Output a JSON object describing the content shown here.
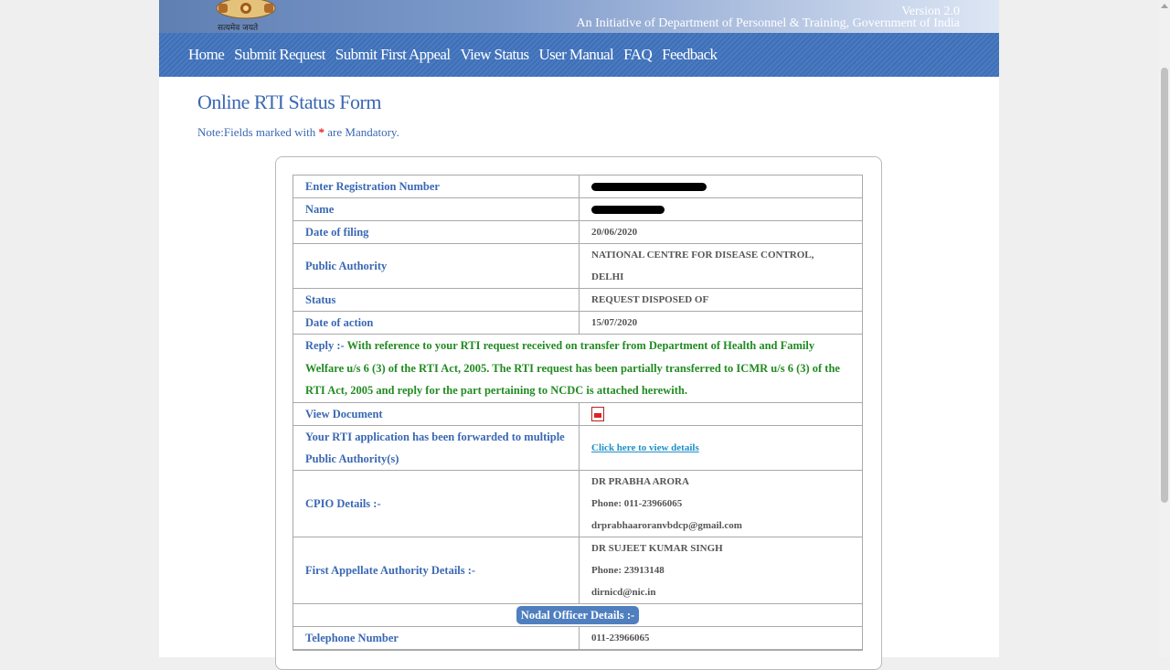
{
  "header": {
    "emblem_caption": "सत्यमेव जयते",
    "version": "Version 2.0",
    "initiative": "An Initiative of Department of Personnel & Training, Government of India"
  },
  "nav": {
    "items": [
      "Home",
      "Submit Request",
      "Submit First Appeal",
      "View Status",
      "User Manual",
      "FAQ",
      "Feedback"
    ]
  },
  "page": {
    "title": "Online RTI Status Form",
    "note_prefix": "Note:Fields marked with",
    "note_star": "*",
    "note_suffix": "are Mandatory."
  },
  "details": {
    "registration_label": "Enter Registration Number",
    "name_label": "Name",
    "date_filing_label": "Date of filing",
    "date_filing": "20/06/2020",
    "public_authority_label": "Public Authority",
    "public_authority_line1": "NATIONAL CENTRE FOR DISEASE CONTROL,",
    "public_authority_line2": "DELHI",
    "status_label": "Status",
    "status": "REQUEST DISPOSED OF",
    "date_action_label": "Date of action",
    "date_action": "15/07/2020",
    "reply_label": "Reply :-",
    "reply_text": "With reference to your RTI request received on transfer from Department of Health and Family Welfare u/s 6 (3) of the RTI Act, 2005.  The RTI request has been partially transferred to ICMR u/s 6 (3) of the RTI Act, 2005 and reply for the part pertaining to NCDC is attached herewith.",
    "view_document_label": "View Document",
    "forwarded_label": "Your RTI application has been forwarded to multiple Public Authority(s)",
    "forwarded_link": "Click here to view details",
    "cpio_label": "CPIO Details :-",
    "cpio_name": "DR PRABHA ARORA",
    "cpio_phone": "Phone: 011-23966065",
    "cpio_email": "drprabhaaroranvbdcp@gmail.com",
    "faa_label": "First Appellate Authority Details :-",
    "faa_name": "DR SUJEET KUMAR SINGH",
    "faa_phone": "Phone: 23913148",
    "faa_email": "dirnicd@nic.in",
    "nodal_header": "Nodal Officer Details :-",
    "telephone_label": "Telephone Number",
    "telephone": "011-23966065"
  },
  "colors": {
    "accent": "#3a68b3",
    "reply_text": "#228b22",
    "nav_bg": "#4a7bc1",
    "link": "#1e90c8"
  },
  "icons": {
    "emblem": "national-emblem-icon",
    "document": "pdf-document-icon"
  }
}
